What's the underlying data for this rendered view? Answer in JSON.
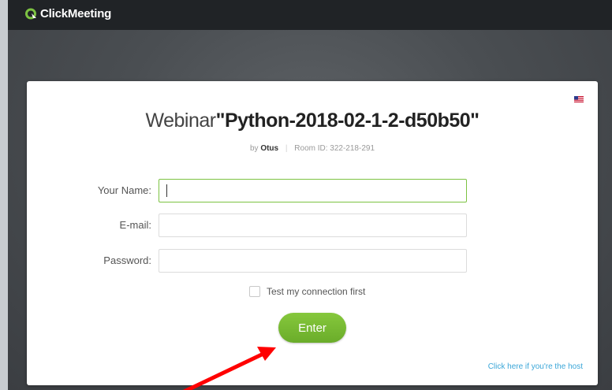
{
  "app": {
    "brand": "ClickMeeting",
    "brand_color": "#7cc242"
  },
  "locale_flag": "us-flag-icon",
  "webinar": {
    "prefix": "Webinar",
    "name": "\"Python-2018-02-1-2-d50b50\"",
    "by_label": "by",
    "host": "Otus",
    "room_id_label": "Room ID: 322-218-291"
  },
  "form": {
    "name_label": "Your Name:",
    "name_value": "",
    "email_label": "E-mail:",
    "email_value": "",
    "password_label": "Password:",
    "password_value": "",
    "test_connection_label": "Test my connection first",
    "test_connection_checked": false,
    "enter_label": "Enter"
  },
  "host_link": "Click here if you're the host",
  "colors": {
    "accent_green": "#7cc242",
    "link_blue": "#3aa6d8",
    "annotation_red": "#ff0000"
  }
}
